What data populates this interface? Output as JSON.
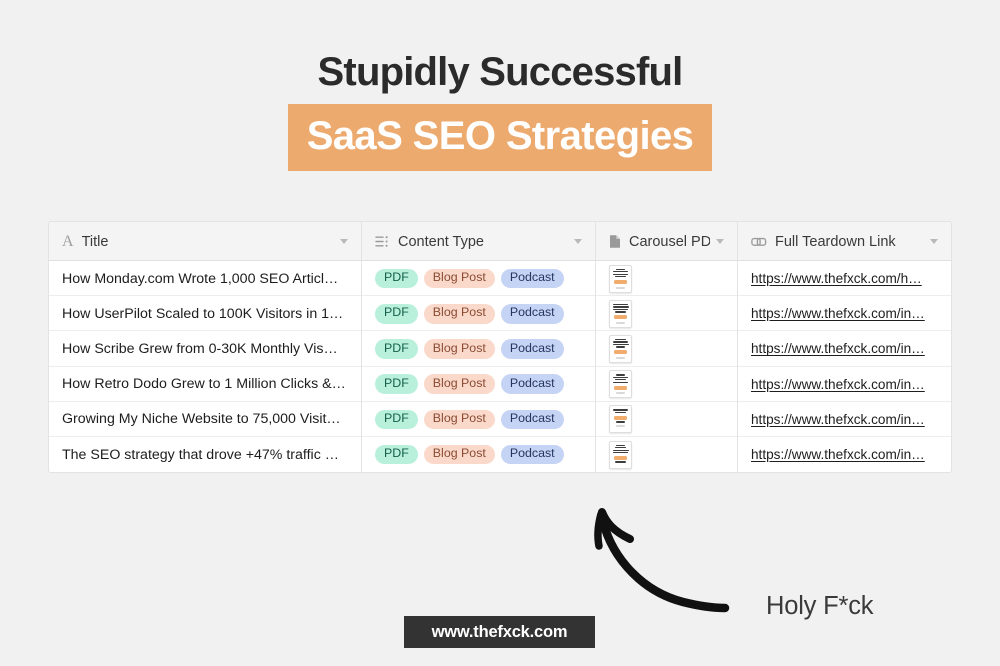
{
  "headline": {
    "line1": "Stupidly Successful",
    "line2": "SaaS SEO Strategies",
    "highlight_color": "#edaa6f",
    "line1_color": "#2b2b2b"
  },
  "table": {
    "columns": [
      {
        "label": "Title",
        "icon": "text-A-icon",
        "has_caret": true
      },
      {
        "label": "Content Type",
        "icon": "multi-select-list-icon",
        "has_caret": true
      },
      {
        "label": "Carousel PDF",
        "icon": "file-document-icon",
        "has_caret": true
      },
      {
        "label": "Full Teardown Link",
        "icon": "link-icon",
        "has_caret": true
      }
    ],
    "tag_colors": {
      "pdf_bg": "#b9f0dc",
      "pdf_text": "#14604a",
      "blog_bg": "#fad9cb",
      "blog_text": "#8a4a32",
      "podcast_bg": "#c5d3f5",
      "podcast_text": "#24365f"
    },
    "rows": [
      {
        "title": "How Monday.com Wrote 1,000 SEO Articl…",
        "tags": [
          "PDF",
          "Blog Post",
          "Podcast"
        ],
        "carousel_pdf": "pdf-thumbnail",
        "link": "https://www.thefxck.com/h…"
      },
      {
        "title": "How UserPilot Scaled to 100K Visitors in 1…",
        "tags": [
          "PDF",
          "Blog Post",
          "Podcast"
        ],
        "carousel_pdf": "pdf-thumbnail",
        "link": "https://www.thefxck.com/in…"
      },
      {
        "title": "How Scribe Grew from 0-30K Monthly Vis…",
        "tags": [
          "PDF",
          "Blog Post",
          "Podcast"
        ],
        "carousel_pdf": "pdf-thumbnail",
        "link": "https://www.thefxck.com/in…"
      },
      {
        "title": "How Retro Dodo Grew to 1 Million Clicks &…",
        "tags": [
          "PDF",
          "Blog Post",
          "Podcast"
        ],
        "carousel_pdf": "pdf-thumbnail",
        "link": "https://www.thefxck.com/in…"
      },
      {
        "title": "Growing My Niche Website to 75,000 Visit…",
        "tags": [
          "PDF",
          "Blog Post",
          "Podcast"
        ],
        "carousel_pdf": "pdf-thumbnail",
        "link": "https://www.thefxck.com/in…"
      },
      {
        "title": "The SEO strategy that drove +47% traffic …",
        "tags": [
          "PDF",
          "Blog Post",
          "Podcast"
        ],
        "carousel_pdf": "pdf-thumbnail",
        "link": "https://www.thefxck.com/in…"
      }
    ]
  },
  "annotation": {
    "arrow": "curved-arrow-up-left",
    "caption": "Holy F*ck"
  },
  "footer": {
    "badge_text": "www.thefxck.com",
    "badge_bg": "#333333"
  }
}
